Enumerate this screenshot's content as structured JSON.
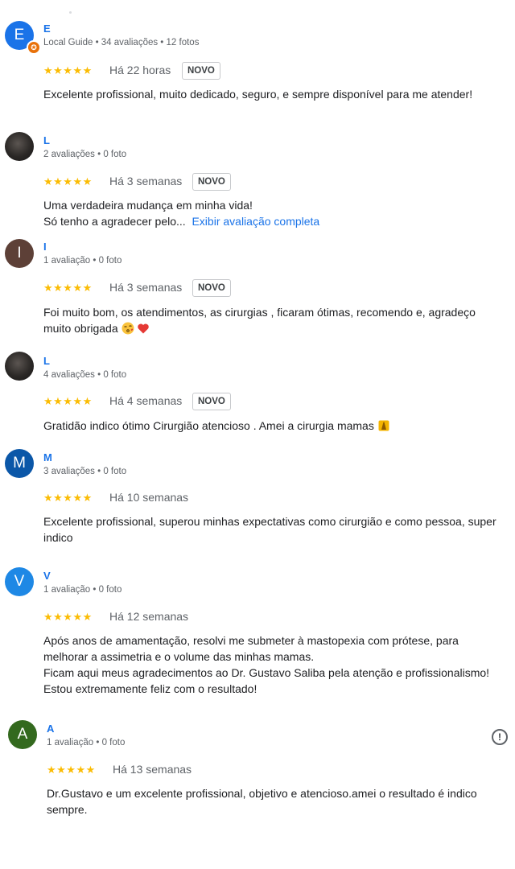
{
  "reviews": [
    {
      "initial": "E",
      "avatar_color": "#1a73e8",
      "name": "E",
      "meta": "Local Guide • 34 avaliações • 12 fotos",
      "stars": "★★★★★",
      "date": "Há 22 horas",
      "badge": "NOVO",
      "text": "Excelente profissional, muito dedicado, seguro, e sempre disponível para me atender!"
    },
    {
      "initial": "",
      "name": "L",
      "meta": "2 avaliações • 0 foto",
      "stars": "★★★★★",
      "date": "Há 3 semanas",
      "badge": "NOVO",
      "text_line1": "Uma verdadeira mudança em minha vida!",
      "text_line2": "Só tenho a agradecer pelo...",
      "more_link": "Exibir avaliação completa"
    },
    {
      "initial": "I",
      "avatar_color": "#5d4037",
      "name": "I",
      "meta": "1 avaliação • 0 foto",
      "stars": "★★★★★",
      "date": "Há 3 semanas",
      "badge": "NOVO",
      "text_line1": "Foi muito bom, os atendimentos, as cirurgias , ficaram ótimas, recomendo e, agradeço",
      "text_line2": "muito obrigada"
    },
    {
      "initial": "",
      "name": "L",
      "meta": "4 avaliações • 0 foto",
      "stars": "★★★★★",
      "date": "Há 4 semanas",
      "badge": "NOVO",
      "text": "Gratidão indico ótimo Cirurgião atencioso . Amei a cirurgia mamas"
    },
    {
      "initial": "M",
      "avatar_color": "#0b57a8",
      "name": "M",
      "meta": "3 avaliações • 0 foto",
      "stars": "★★★★★",
      "date": "Há 10 semanas",
      "text_line1": "Excelente profissional, superou minhas expectativas como cirurgião e como pessoa, super",
      "text_line2": "indico"
    },
    {
      "initial": "V",
      "avatar_color": "#1e88e5",
      "name": "V",
      "meta": "1 avaliação • 0 foto",
      "stars": "★★★★★",
      "date": "Há 12 semanas",
      "text_line1": "Após anos de amamentação, resolvi me submeter à mastopexia com prótese, para",
      "text_line2": "melhorar a assimetria e o volume das minhas mamas.",
      "text_line3": "Ficam aqui meus agradecimentos ao Dr. Gustavo Saliba pela atenção e profissionalismo!",
      "text_line4": "Estou extremamente feliz com o resultado!"
    },
    {
      "initial": "A",
      "avatar_color": "#33691e",
      "name": "A",
      "meta": "1 avaliação • 0 foto",
      "stars": "★★★★★",
      "date": "Há 13 semanas",
      "text_line1": "Dr.Gustavo e um excelente profissional, objetivo e atencioso.amei o resultado é indico",
      "text_line2": "sempre.",
      "flag_icon": "report-icon"
    }
  ]
}
